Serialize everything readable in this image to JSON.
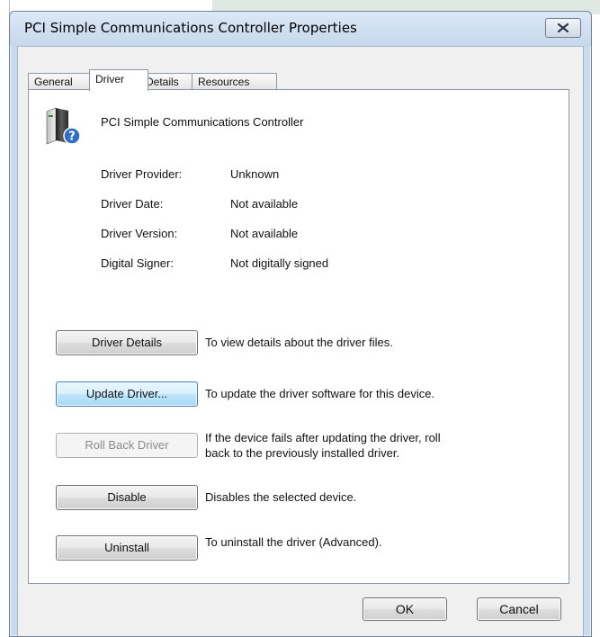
{
  "window": {
    "title": "PCI Simple Communications Controller Properties"
  },
  "tabs": [
    {
      "label": "General"
    },
    {
      "label": "Driver"
    },
    {
      "label": "Details"
    },
    {
      "label": "Resources"
    }
  ],
  "device": {
    "name": "PCI Simple Communications Controller",
    "icon": "device-unknown-icon"
  },
  "info": [
    {
      "label": "Driver Provider:",
      "value": "Unknown"
    },
    {
      "label": "Driver Date:",
      "value": "Not available"
    },
    {
      "label": "Driver Version:",
      "value": "Not available"
    },
    {
      "label": "Digital Signer:",
      "value": "Not digitally signed"
    }
  ],
  "actions": [
    {
      "button": "Driver Details",
      "description": "To view details about the driver files."
    },
    {
      "button": "Update Driver...",
      "description": "To update the driver software for this device."
    },
    {
      "button": "Roll Back Driver",
      "description": "If the device fails after updating the driver, roll back to the previously installed driver.",
      "description_line1": "If the device fails after updating the driver, roll",
      "description_line2": "back to the previously installed driver."
    },
    {
      "button": "Disable",
      "description": "Disables the selected device."
    },
    {
      "button": "Uninstall",
      "description": "To uninstall the driver (Advanced)."
    }
  ],
  "footer": {
    "ok": "OK",
    "cancel": "Cancel"
  },
  "colors": {
    "window_frame": "#c9dbef",
    "focus_button": "#bee6fd",
    "disabled_text": "#8a8a8a"
  }
}
